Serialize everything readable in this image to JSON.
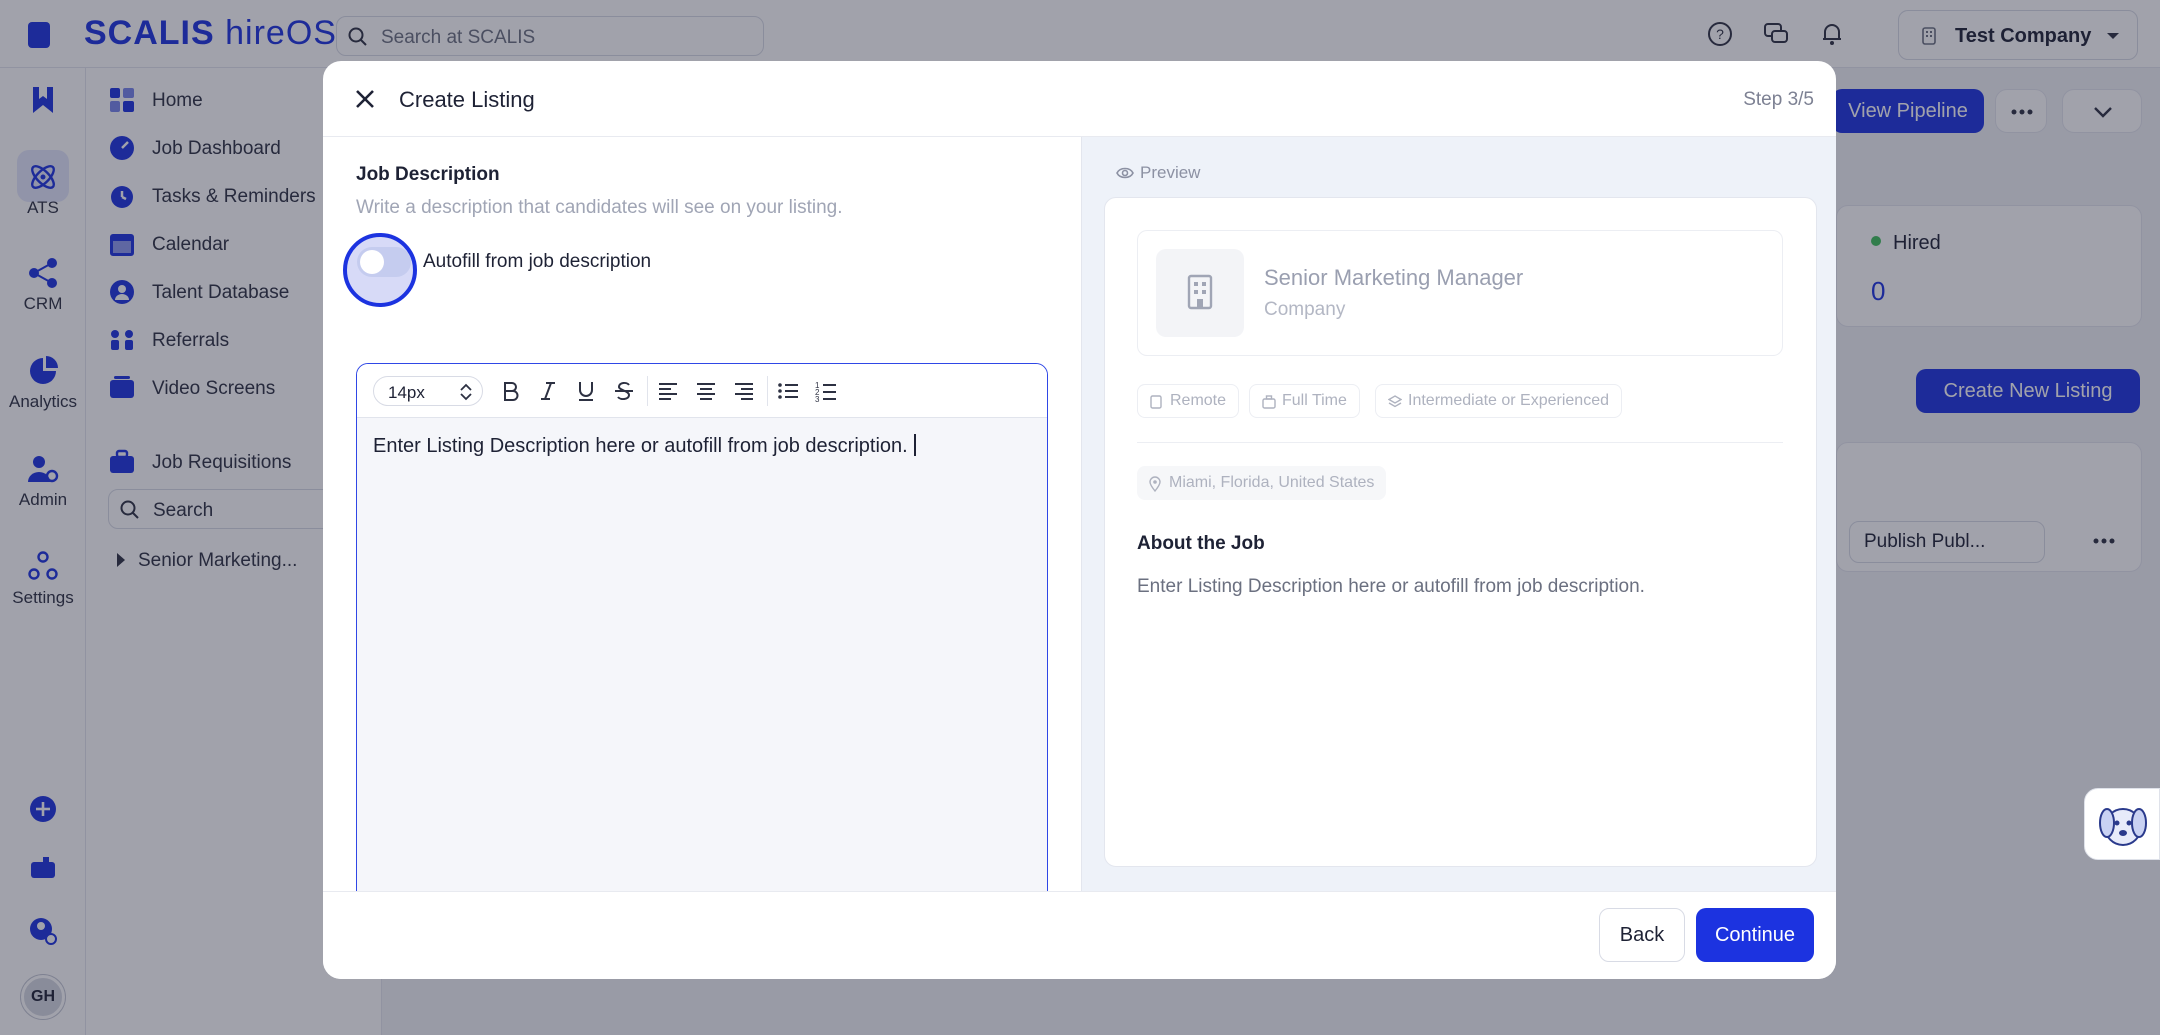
{
  "app": {
    "logo_main": "SCALIS",
    "logo_sub": "hireOS",
    "search_placeholder": "Search at SCALIS",
    "company": "Test Company"
  },
  "rail": {
    "items": [
      {
        "label": "",
        "icon": "bookmark-logo-icon"
      },
      {
        "label": "ATS",
        "icon": "atom-icon"
      },
      {
        "label": "CRM",
        "icon": "network-icon"
      },
      {
        "label": "Analytics",
        "icon": "pie-chart-icon"
      },
      {
        "label": "Admin",
        "icon": "user-gear-icon"
      },
      {
        "label": "Settings",
        "icon": "settings-nodes-icon"
      }
    ],
    "avatar": "GH"
  },
  "nav": {
    "items": [
      {
        "label": "Home",
        "icon": "home-grid-icon"
      },
      {
        "label": "Job Dashboard",
        "icon": "gauge-icon"
      },
      {
        "label": "Tasks & Reminders",
        "icon": "alarm-icon"
      },
      {
        "label": "Calendar",
        "icon": "calendar-icon"
      },
      {
        "label": "Talent Database",
        "icon": "person-circle-icon"
      },
      {
        "label": "Referrals",
        "icon": "referral-icon"
      },
      {
        "label": "Video Screens",
        "icon": "video-icon"
      },
      {
        "label": "Job Requisitions",
        "icon": "briefcase-icon"
      }
    ],
    "search_label": "Search",
    "tree_item": "Senior Marketing..."
  },
  "background": {
    "view_pipeline": "View Pipeline",
    "hired_label": "Hired",
    "hired_count": "0",
    "create_new_listing": "Create New Listing",
    "publish_select": "Publish Publ..."
  },
  "modal": {
    "title": "Create Listing",
    "step": "Step 3/5",
    "section_title": "Job Description",
    "section_desc": "Write a description that candidates will see on your listing.",
    "toggle_label": "Autofill from job description",
    "toggle_on": false,
    "font_size": "14px",
    "editor_text": "Enter Listing Description here or autofill from job description.",
    "back_label": "Back",
    "continue_label": "Continue"
  },
  "preview": {
    "label": "Preview",
    "job_title": "Senior Marketing Manager",
    "company": "Company",
    "tags": [
      "Remote",
      "Full Time",
      "Intermediate or Experienced"
    ],
    "location": "Miami, Florida, United States",
    "about_title": "About the Job",
    "about_text": "Enter Listing Description here or autofill from job description."
  },
  "colors": {
    "brand": "#1c33e0",
    "toggle_off": "#c5ccef",
    "preview_bg": "#eef2f9"
  }
}
